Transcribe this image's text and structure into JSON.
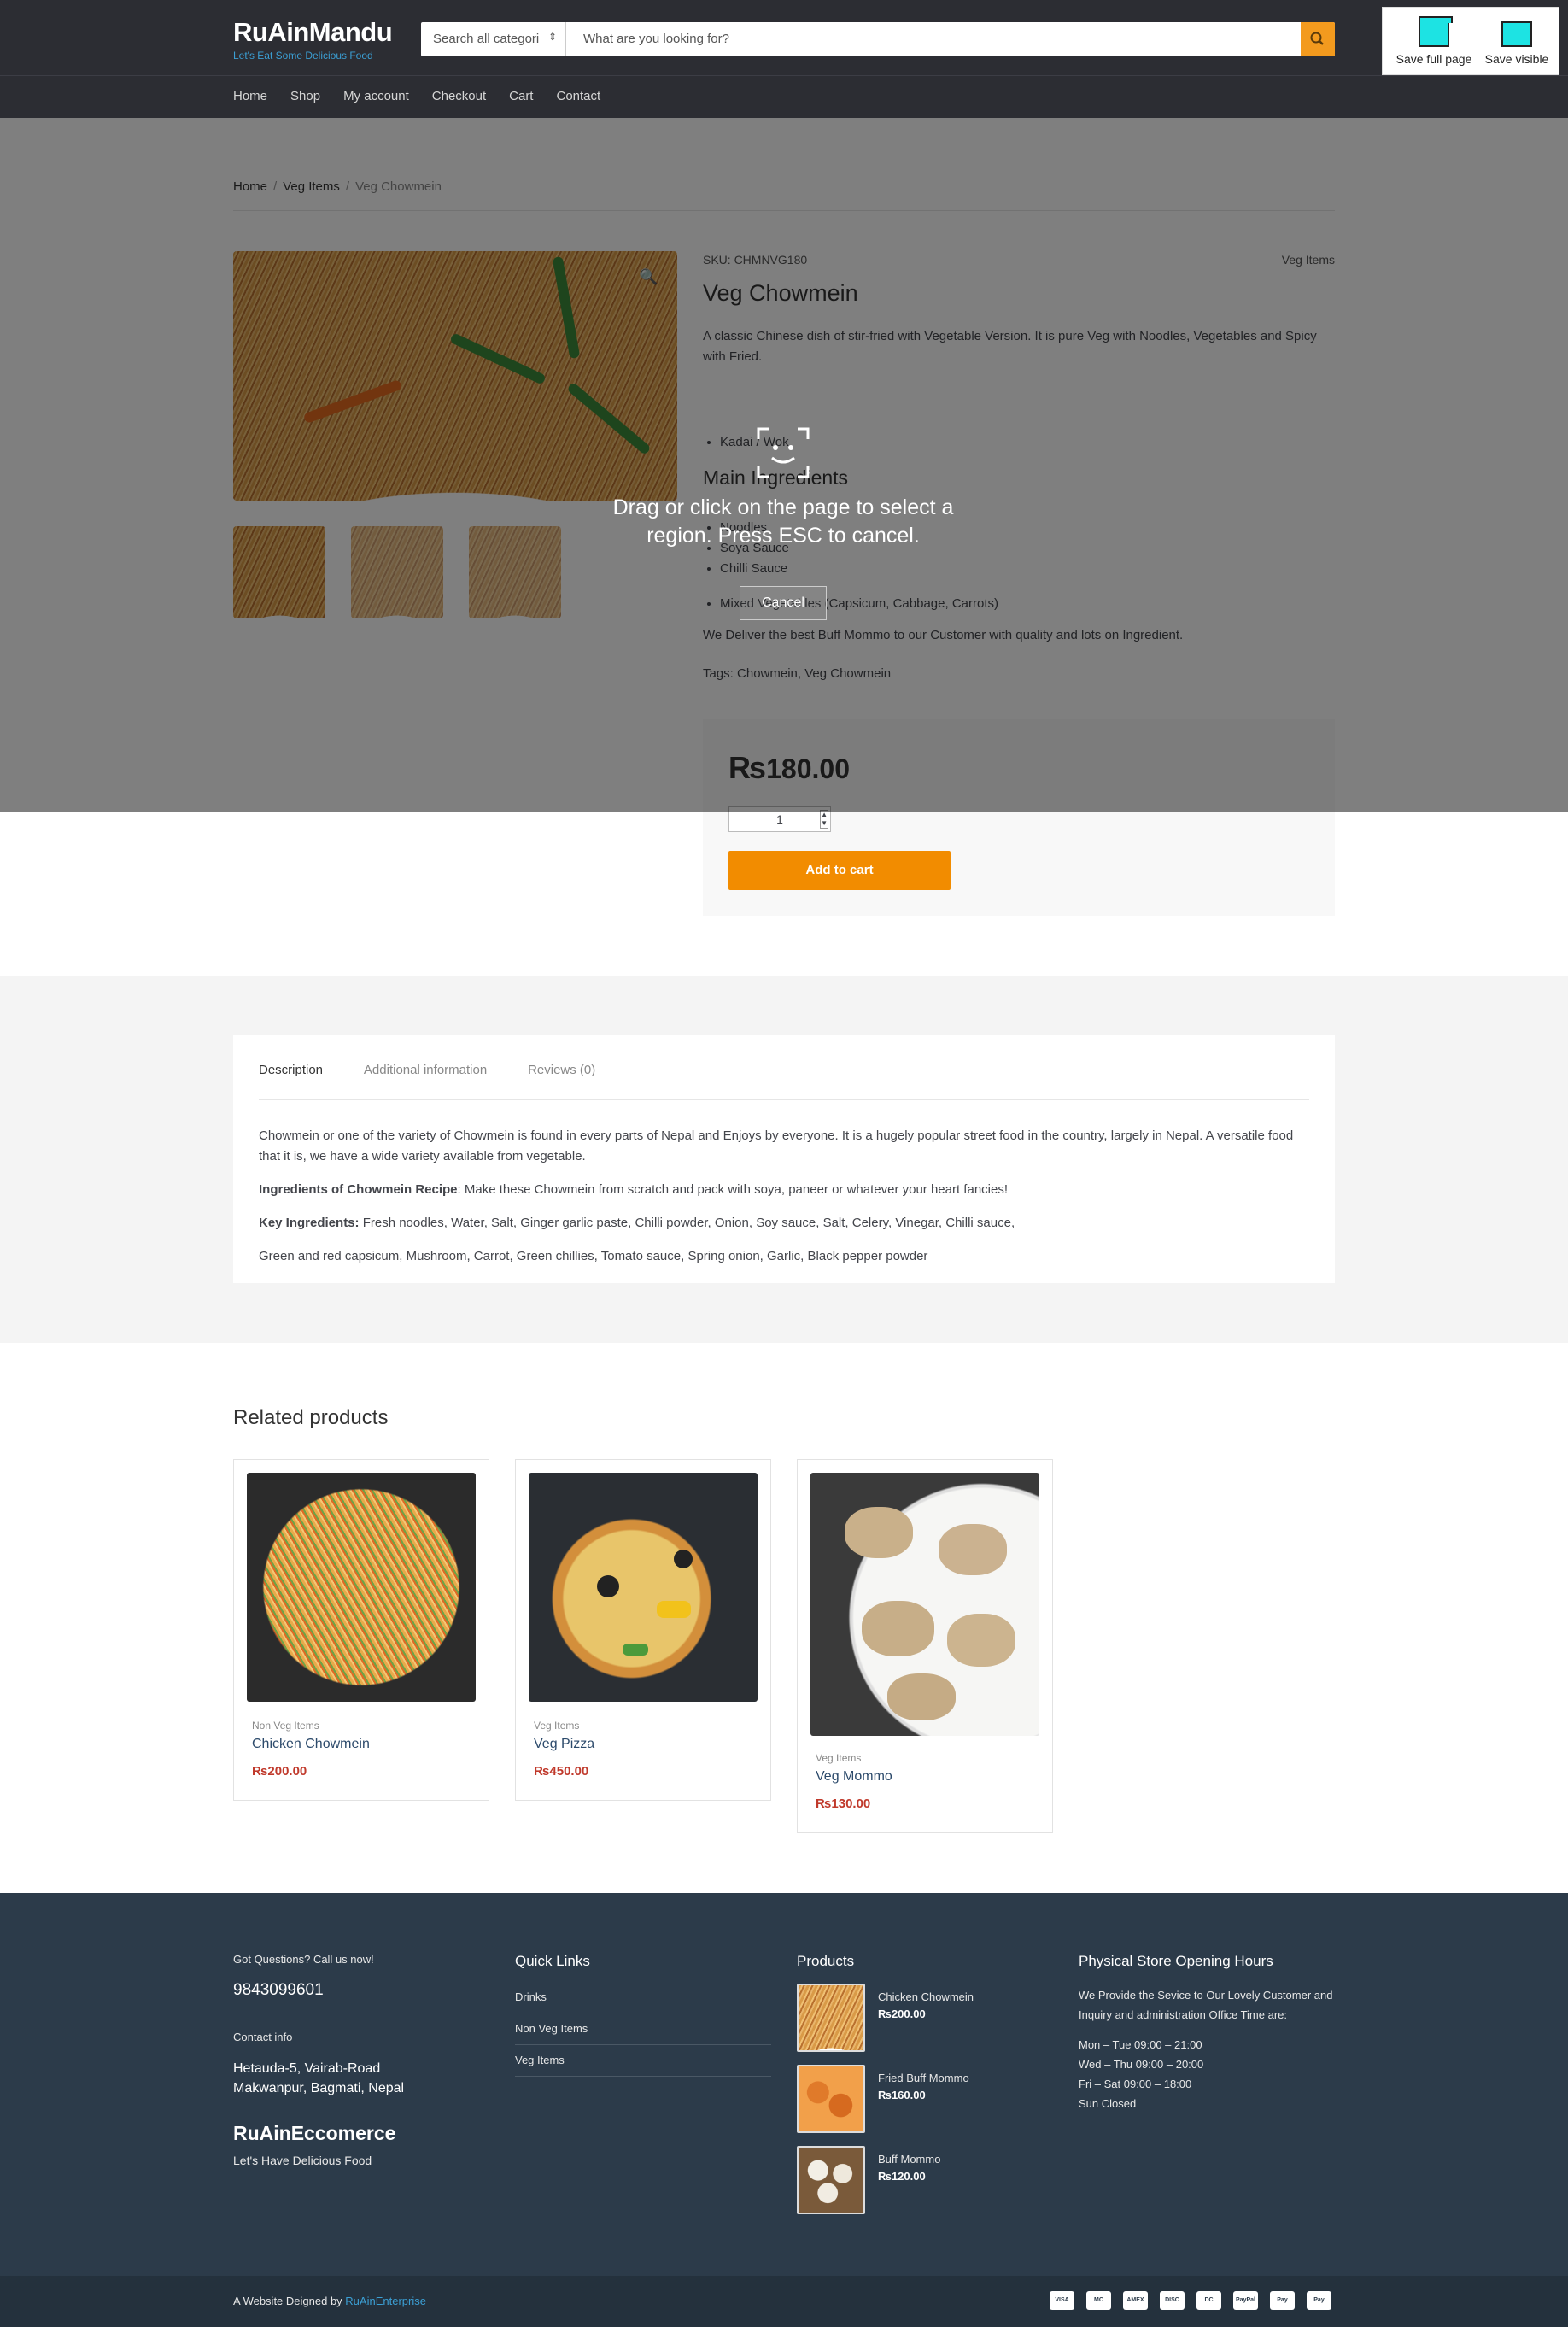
{
  "header": {
    "site_name": "RuAinMandu",
    "tagline": "Let's Eat Some Delicious Food",
    "search_category": "Search all categories",
    "search_placeholder": "What are you looking for?",
    "nav": [
      "Home",
      "Shop",
      "My account",
      "Checkout",
      "Cart",
      "Contact"
    ]
  },
  "extension": {
    "full_label": "Save full page",
    "visible_label": "Save visible"
  },
  "overlay": {
    "instruction": "Drag or click on the page to select a region. Press ESC to cancel.",
    "cancel_label": "Cancel"
  },
  "breadcrumb": [
    "Home",
    "Veg Items",
    "Veg Chowmein"
  ],
  "product": {
    "sku": "SKU: CHMNVG180",
    "category": "Veg Items",
    "title": "Veg Chowmein",
    "short_desc": "A classic Chinese dish of stir-fried with Vegetable Version. It is pure Veg with Noodles, Vegetables and Spicy with Fried.",
    "utensil": "Kadai / Wok",
    "ingredients_title": "Main Ingredients",
    "ingredients": [
      "Noodles",
      "Soya Sauce",
      "Chilli Sauce"
    ],
    "ingredients_extra": "Mixed Vegetables (Capsicum, Cabbage, Carrots)",
    "deliver_note": "We Deliver the best Buff Mommo to our Customer with quality and lots on Ingredient.",
    "tags_label": "Tags:",
    "tags": "Chowmein, Veg Chowmein",
    "currency": "₨",
    "price": "180.00",
    "qty": "1",
    "add_to_cart": "Add to cart"
  },
  "tabs": {
    "items": [
      "Description",
      "Additional information",
      "Reviews (0)"
    ],
    "desc_p1": "Chowmein or one of the variety of Chowmein  is found in every parts of Nepal and Enjoys by everyone. It is a hugely popular street food in the country, largely in Nepal. A versatile food that it is, we have a wide variety available from vegetable.",
    "desc_p2_bold": "Ingredients of Chowmein Recipe",
    "desc_p2": ": Make these Chowmein from scratch and pack with  soya, paneer or whatever your heart fancies!",
    "desc_p3_bold": "Key Ingredients:",
    "desc_p3": " Fresh noodles, Water, Salt, Ginger garlic paste, Chilli powder, Onion, Soy sauce, Salt, Celery, Vinegar, Chilli sauce,",
    "desc_p4": "Green and red capsicum, Mushroom, Carrot, Green chillies, Tomato sauce, Spring onion, Garlic, Black pepper powder"
  },
  "related": {
    "title": "Related products",
    "items": [
      {
        "cat": "Non Veg Items",
        "name": "Chicken Chowmein",
        "price": "200.00"
      },
      {
        "cat": "Veg Items",
        "name": "Veg Pizza",
        "price": "450.00"
      },
      {
        "cat": "Veg Items",
        "name": "Veg Mommo",
        "price": "130.00"
      }
    ]
  },
  "footer": {
    "questions": "Got Questions? Call us now!",
    "phone": "9843099601",
    "contact_label": "Contact info",
    "address1": "Hetauda-5, Vairab-Road",
    "address2": "Makwanpur, Bagmati, Nepal",
    "brand": "RuAinEccomerce",
    "brand_tag": "Let's Have Delicious Food",
    "quick_title": "Quick Links",
    "quick_links": [
      "Drinks",
      "Non Veg Items",
      "Veg Items"
    ],
    "products_title": "Products",
    "products": [
      {
        "name": "Chicken Chowmein",
        "price": "200.00"
      },
      {
        "name": "Fried Buff Mommo",
        "price": "160.00"
      },
      {
        "name": "Buff Mommo",
        "price": "120.00"
      }
    ],
    "hours_title": "Physical Store Opening Hours",
    "hours_intro": "We Provide the Sevice to Our Lovely Customer and Inquiry and administration Office Time are:",
    "hours": [
      "Mon – Tue 09:00 – 21:00",
      "Wed – Thu 09:00 – 20:00",
      "Fri – Sat 09:00 – 18:00",
      "Sun Closed"
    ],
    "credit_prefix": "A Website Deigned by ",
    "credit_link": "RuAinEnterprise",
    "payments": [
      "VISA",
      "MC",
      "AMEX",
      "DISC",
      "DC",
      "PayPal",
      "Pay",
      "Pay"
    ]
  }
}
